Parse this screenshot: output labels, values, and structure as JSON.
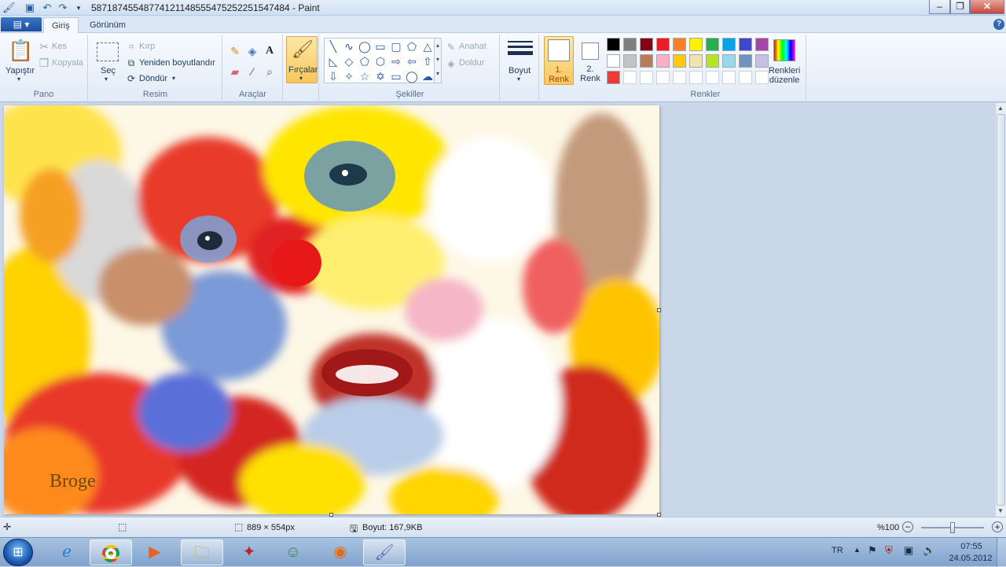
{
  "window": {
    "title": "58718745548774121148555475252251547484 - Paint"
  },
  "tabs": [
    {
      "label": "Giriş"
    },
    {
      "label": "Görünüm"
    }
  ],
  "ribbon": {
    "pano": {
      "label": "Pano",
      "paste": "Yapıştır",
      "cut": "Kes",
      "copy": "Kopyala"
    },
    "resim": {
      "label": "Resim",
      "select": "Seç",
      "crop": "Kırp",
      "resize": "Yeniden boyutlandır",
      "rotate": "Döndür"
    },
    "araclar": {
      "label": "Araçlar"
    },
    "brushes": "Fırçalar",
    "sekiller": {
      "label": "Şekiller",
      "outline": "Anahat",
      "fill": "Doldur"
    },
    "size": "Boyut",
    "color1": "1. Renk",
    "color2": "2. Renk",
    "renkler": {
      "label": "Renkler",
      "edit": "Renkleri düzenle"
    }
  },
  "palette": {
    "row1": [
      "#000000",
      "#7f7f7f",
      "#880015",
      "#ed1c24",
      "#ff7f27",
      "#fff200",
      "#22b14c",
      "#00a2e8",
      "#3f48cc",
      "#a349a4"
    ],
    "row2": [
      "#ffffff",
      "#c3c3c3",
      "#b97a57",
      "#ffaec9",
      "#ffc90e",
      "#efe4b0",
      "#b5e61d",
      "#99d9ea",
      "#7092be",
      "#c8bfe7"
    ],
    "row3": [
      "#ed3b35",
      "#ffffff",
      "#ffffff",
      "#ffffff",
      "#ffffff",
      "#ffffff",
      "#ffffff",
      "#ffffff",
      "#ffffff",
      "#ffffff"
    ]
  },
  "canvas": {
    "signature": "Broge"
  },
  "status": {
    "dimensions": "889 × 554px",
    "size": "Boyut: 167,9KB",
    "zoom": "%100",
    "zoom_level": 0.5
  },
  "taskbar": {
    "lang": "TR",
    "time": "07:55",
    "date": "24.05.2012"
  }
}
